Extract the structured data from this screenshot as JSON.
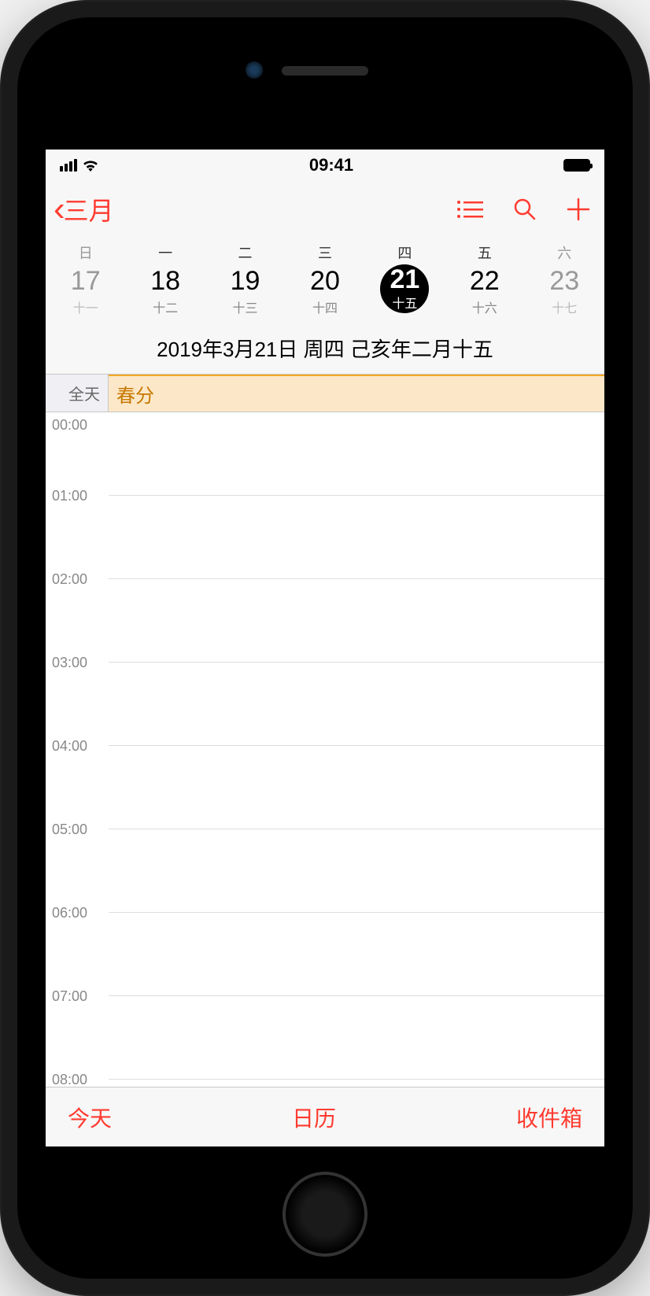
{
  "status": {
    "time": "09:41"
  },
  "nav": {
    "back_label": "三月"
  },
  "week": {
    "weekdays": [
      "日",
      "一",
      "二",
      "三",
      "四",
      "五",
      "六"
    ],
    "days": [
      {
        "num": "17",
        "lunar": "十一",
        "weekend": true
      },
      {
        "num": "18",
        "lunar": "十二"
      },
      {
        "num": "19",
        "lunar": "十三"
      },
      {
        "num": "20",
        "lunar": "十四"
      },
      {
        "num": "21",
        "lunar": "十五",
        "selected": true
      },
      {
        "num": "22",
        "lunar": "十六"
      },
      {
        "num": "23",
        "lunar": "十七",
        "weekend": true
      }
    ]
  },
  "date_label": "2019年3月21日 周四  己亥年二月十五",
  "all_day": {
    "label": "全天",
    "event": "春分"
  },
  "hours": [
    "00:00",
    "01:00",
    "02:00",
    "03:00",
    "04:00",
    "05:00",
    "06:00",
    "07:00",
    "08:00"
  ],
  "toolbar": {
    "today": "今天",
    "calendars": "日历",
    "inbox": "收件箱"
  }
}
